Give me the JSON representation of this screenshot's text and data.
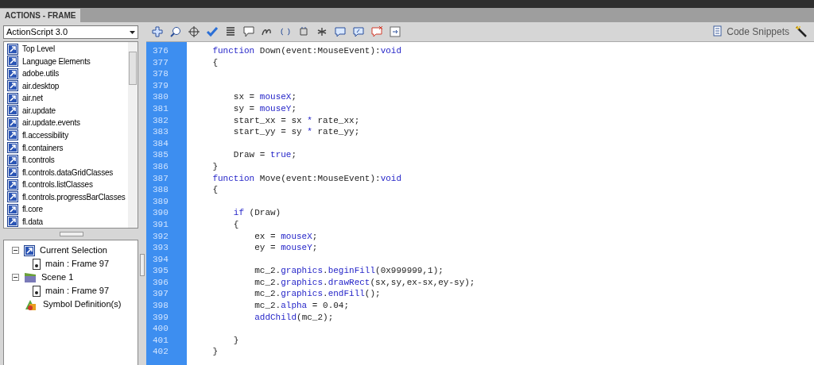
{
  "panel_tab": {
    "label": "ACTIONS - FRAME",
    "selected": true
  },
  "language_select": {
    "value": "ActionScript 3.0"
  },
  "code_snippets": {
    "label": "Code Snippets"
  },
  "library": {
    "items": [
      "Top Level",
      "Language Elements",
      "adobe.utils",
      "air.desktop",
      "air.net",
      "air.update",
      "air.update.events",
      "fl.accessibility",
      "fl.containers",
      "fl.controls",
      "fl.controls.dataGridClasses",
      "fl.controls.listClasses",
      "fl.controls.progressBarClasses",
      "fl.core",
      "fl.data"
    ]
  },
  "tree": [
    {
      "label": "Current Selection",
      "kind": "selection",
      "expanded": true,
      "children": [
        {
          "label": "main : Frame 97",
          "kind": "frame"
        }
      ]
    },
    {
      "label": "Scene 1",
      "kind": "scene",
      "expanded": true,
      "children": [
        {
          "label": "main : Frame 97",
          "kind": "frame"
        }
      ]
    },
    {
      "label": "Symbol Definition(s)",
      "kind": "symbol"
    }
  ],
  "code": [
    {
      "number": "376",
      "tokens": [
        {
          "text": "    function",
          "kind": "keyword"
        },
        {
          "text": " Down(event:MouseEvent):"
        },
        {
          "text": "void",
          "kind": "keyword"
        }
      ]
    },
    {
      "number": "377",
      "tokens": [
        {
          "text": "    {"
        }
      ]
    },
    {
      "number": "378"
    },
    {
      "number": "379"
    },
    {
      "number": "380",
      "tokens": [
        {
          "text": "        sx = "
        },
        {
          "text": "mouseX",
          "kind": "keyword"
        },
        {
          "text": ";"
        }
      ]
    },
    {
      "number": "381",
      "tokens": [
        {
          "text": "        sy = "
        },
        {
          "text": "mouseY",
          "kind": "keyword"
        },
        {
          "text": ";"
        }
      ]
    },
    {
      "number": "382",
      "tokens": [
        {
          "text": "        start_xx = sx "
        },
        {
          "text": "*",
          "kind": "keyword"
        },
        {
          "text": " rate_xx;"
        }
      ]
    },
    {
      "number": "383",
      "tokens": [
        {
          "text": "        start_yy = sy "
        },
        {
          "text": "*",
          "kind": "keyword"
        },
        {
          "text": " rate_yy;"
        }
      ]
    },
    {
      "number": "384"
    },
    {
      "number": "385",
      "tokens": [
        {
          "text": "        Draw = "
        },
        {
          "text": "true",
          "kind": "keyword"
        },
        {
          "text": ";"
        }
      ]
    },
    {
      "number": "386",
      "tokens": [
        {
          "text": "    }"
        }
      ]
    },
    {
      "number": "387",
      "tokens": [
        {
          "text": "    function",
          "kind": "keyword"
        },
        {
          "text": " Move(event:MouseEvent):"
        },
        {
          "text": "void",
          "kind": "keyword"
        }
      ]
    },
    {
      "number": "388",
      "tokens": [
        {
          "text": "    {"
        }
      ]
    },
    {
      "number": "389"
    },
    {
      "number": "390",
      "tokens": [
        {
          "text": "        if",
          "kind": "keyword"
        },
        {
          "text": " (Draw)"
        }
      ]
    },
    {
      "number": "391",
      "tokens": [
        {
          "text": "        {"
        }
      ]
    },
    {
      "number": "392",
      "tokens": [
        {
          "text": "            ex = "
        },
        {
          "text": "mouseX",
          "kind": "keyword"
        },
        {
          "text": ";"
        }
      ]
    },
    {
      "number": "393",
      "tokens": [
        {
          "text": "            ey = "
        },
        {
          "text": "mouseY",
          "kind": "keyword"
        },
        {
          "text": ";"
        }
      ]
    },
    {
      "number": "394"
    },
    {
      "number": "395",
      "tokens": [
        {
          "text": "            mc_2."
        },
        {
          "text": "graphics",
          "kind": "keyword"
        },
        {
          "text": "."
        },
        {
          "text": "beginFill",
          "kind": "keyword"
        },
        {
          "text": "(0x999999,1);"
        }
      ]
    },
    {
      "number": "396",
      "tokens": [
        {
          "text": "            mc_2."
        },
        {
          "text": "graphics",
          "kind": "keyword"
        },
        {
          "text": "."
        },
        {
          "text": "drawRect",
          "kind": "keyword"
        },
        {
          "text": "(sx,sy,ex-sx,ey-sy);"
        }
      ]
    },
    {
      "number": "397",
      "tokens": [
        {
          "text": "            mc_2."
        },
        {
          "text": "graphics",
          "kind": "keyword"
        },
        {
          "text": "."
        },
        {
          "text": "endFill",
          "kind": "keyword"
        },
        {
          "text": "();"
        }
      ]
    },
    {
      "number": "398",
      "tokens": [
        {
          "text": "            mc_2."
        },
        {
          "text": "alpha",
          "kind": "keyword"
        },
        {
          "text": " = 0.04;"
        }
      ]
    },
    {
      "number": "399",
      "tokens": [
        {
          "text": "            addChild",
          "kind": "keyword"
        },
        {
          "text": "(mc_2);"
        }
      ]
    },
    {
      "number": "400"
    },
    {
      "number": "401",
      "tokens": [
        {
          "text": "        }"
        }
      ]
    },
    {
      "number": "402",
      "tokens": [
        {
          "text": "    }"
        }
      ]
    }
  ]
}
